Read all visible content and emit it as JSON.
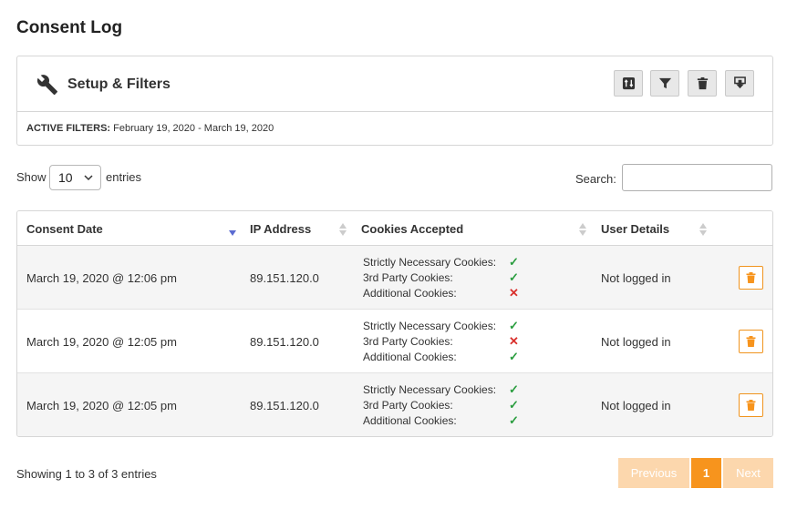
{
  "page": {
    "title": "Consent Log"
  },
  "setup": {
    "title": "Setup & Filters",
    "tools": [
      {
        "name": "sort-toggle-icon"
      },
      {
        "name": "filter-icon"
      },
      {
        "name": "trash-icon"
      },
      {
        "name": "download-icon"
      }
    ],
    "active_filters_label": "ACTIVE FILTERS:",
    "active_filters_value": "February 19, 2020 - March 19, 2020"
  },
  "length_control": {
    "show_label": "Show",
    "selected": "10",
    "entries_label": "entries"
  },
  "search": {
    "label": "Search:",
    "value": "",
    "placeholder": ""
  },
  "table": {
    "columns": [
      "Consent Date",
      "IP Address",
      "Cookies Accepted",
      "User Details"
    ],
    "rows": [
      {
        "date": "March 19, 2020 @ 12:06 pm",
        "ip": "89.151.120.0",
        "cookies": [
          {
            "label": "Strictly Necessary Cookies:",
            "mark": "✓",
            "accepted": true
          },
          {
            "label": "3rd Party Cookies:",
            "mark": "✓",
            "accepted": true
          },
          {
            "label": "Additional Cookies:",
            "mark": "✕",
            "accepted": false
          }
        ],
        "user": "Not logged in"
      },
      {
        "date": "March 19, 2020 @ 12:05 pm",
        "ip": "89.151.120.0",
        "cookies": [
          {
            "label": "Strictly Necessary Cookies:",
            "mark": "✓",
            "accepted": true
          },
          {
            "label": "3rd Party Cookies:",
            "mark": "✕",
            "accepted": false
          },
          {
            "label": "Additional Cookies:",
            "mark": "✓",
            "accepted": true
          }
        ],
        "user": "Not logged in"
      },
      {
        "date": "March 19, 2020 @ 12:05 pm",
        "ip": "89.151.120.0",
        "cookies": [
          {
            "label": "Strictly Necessary Cookies:",
            "mark": "✓",
            "accepted": true
          },
          {
            "label": "3rd Party Cookies:",
            "mark": "✓",
            "accepted": true
          },
          {
            "label": "Additional Cookies:",
            "mark": "✓",
            "accepted": true
          }
        ],
        "user": "Not logged in"
      }
    ]
  },
  "info": "Showing 1 to 3 of 3 entries",
  "pagination": {
    "previous": "Previous",
    "current": "1",
    "next": "Next"
  },
  "colors": {
    "accent": "#f7941d",
    "accent_light": "#fcd7ad",
    "accepted": "#2a9d3f",
    "rejected": "#d9302c"
  }
}
